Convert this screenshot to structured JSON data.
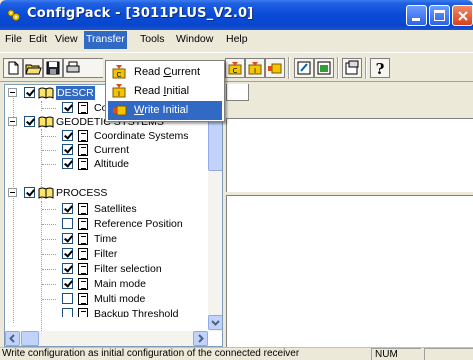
{
  "window": {
    "title": "ConfigPack - [3011PLUS_V2.0]"
  },
  "menu": {
    "items": [
      "File",
      "Edit",
      "View",
      "Transfer",
      "Tools",
      "Window",
      "Help"
    ],
    "active": "Transfer"
  },
  "transfer_menu": {
    "items": [
      {
        "label": "Read ",
        "mnemonic": "C",
        "rest": "urrent",
        "icon": "read-current-icon"
      },
      {
        "label": "Read ",
        "mnemonic": "I",
        "rest": "nitial",
        "icon": "read-initial-icon"
      },
      {
        "label": "",
        "mnemonic": "W",
        "rest": "rite Initial",
        "icon": "write-initial-icon",
        "highlighted": true
      }
    ]
  },
  "tree": {
    "groups": [
      {
        "label": "DESCR",
        "checked": true,
        "children": [
          {
            "label": "Cor",
            "checked": true
          }
        ]
      },
      {
        "label": "GEODETIC SYSTEMS",
        "checked": true,
        "children": [
          {
            "label": "Coordinate Systems",
            "checked": true
          },
          {
            "label": "Current",
            "checked": true
          },
          {
            "label": "Altitude",
            "checked": true
          }
        ]
      },
      {
        "label": "PROCESS",
        "checked": true,
        "children": [
          {
            "label": "Satellites",
            "checked": true
          },
          {
            "label": "Reference Position",
            "checked": false
          },
          {
            "label": "Time",
            "checked": true
          },
          {
            "label": "Filter",
            "checked": true
          },
          {
            "label": "Filter selection",
            "checked": true
          },
          {
            "label": "Main mode",
            "checked": true
          },
          {
            "label": "Multi mode",
            "checked": false
          },
          {
            "label": "Backup Threshold",
            "checked": false
          }
        ]
      }
    ]
  },
  "status": {
    "message": "Write configuration as initial configuration of the connected receiver",
    "num": "NUM"
  },
  "colors": {
    "title_bar": "#0a4bd8",
    "highlight": "#316ac5",
    "check": "#21a121"
  }
}
